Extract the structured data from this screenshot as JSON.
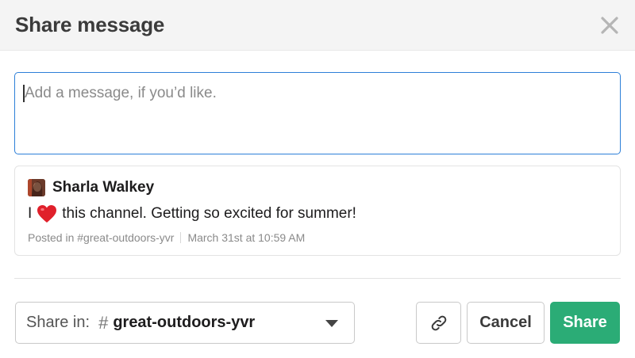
{
  "dialog": {
    "title": "Share message",
    "close_icon": "close-icon"
  },
  "message_input": {
    "placeholder": "Add a message, if you’d like.",
    "value": ""
  },
  "shared_message": {
    "author": "Sharla Walkey",
    "text_before_icon": "I",
    "icon": "red-heart-emoji",
    "text_after_icon": "this channel. Getting so excited for summer!",
    "posted_in": "Posted in #great-outdoors-yvr",
    "timestamp": "March 31st at 10:59 AM"
  },
  "share_in": {
    "label": "Share in:",
    "hash_symbol": "#",
    "channel": "great-outdoors-yvr"
  },
  "buttons": {
    "copy_link_icon": "link-icon",
    "cancel_label": "Cancel",
    "share_label": "Share"
  },
  "colors": {
    "accent_focus": "#2d7fd8",
    "share_button": "#2bac76",
    "header_bg": "#f4f4f4"
  }
}
